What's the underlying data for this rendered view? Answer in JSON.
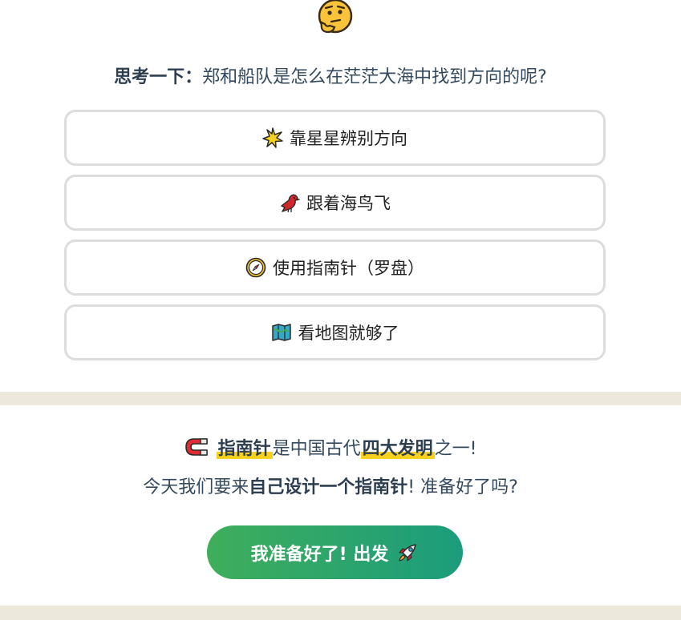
{
  "quiz": {
    "question_label": "思考一下：",
    "question_text": "郑和船队是怎么在茫茫大海中找到方向的呢?",
    "options": [
      {
        "icon": "sparkle-star-icon",
        "label": "靠星星辨别方向"
      },
      {
        "icon": "bird-icon",
        "label": "跟着海鸟飞"
      },
      {
        "icon": "compass-icon",
        "label": "使用指南针（罗盘）"
      },
      {
        "icon": "map-icon",
        "label": "看地图就够了"
      }
    ]
  },
  "intro": {
    "line1_highlight1": "指南针",
    "line1_mid": "是中国古代",
    "line1_highlight2": "四大发明",
    "line1_end": "之一!",
    "line2_start": "今天我们要来",
    "line2_bold": "自己设计一个指南针",
    "line2_end": "! 准备好了吗?",
    "cta_label": "我准备好了! 出发"
  },
  "colors": {
    "background": "#ece8dc",
    "highlight": "#f7d11e",
    "cta_start": "#3fae5b",
    "cta_end": "#1b9c7c",
    "option_border": "#dddddd",
    "text": "#34495e"
  }
}
